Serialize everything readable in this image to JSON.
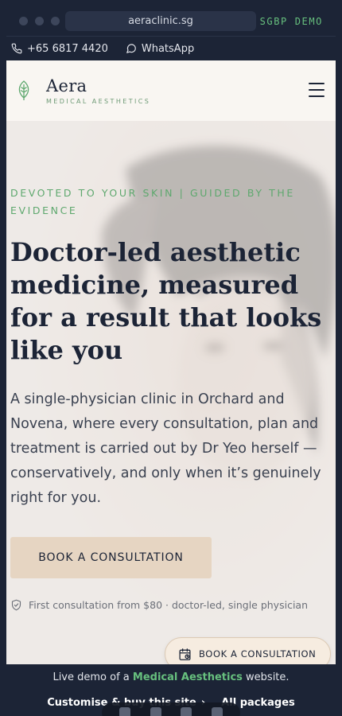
{
  "browser": {
    "url": "aeraclinic.sg",
    "demo_tag": "SGBP DEMO"
  },
  "contact": {
    "phone": "+65 6817 4420",
    "whatsapp": "WhatsApp"
  },
  "header": {
    "brand_name": "Aera",
    "brand_sub": "MEDICAL AESTHETICS"
  },
  "hero": {
    "eyebrow": "DEVOTED TO YOUR SKIN   |   GUIDED BY THE EVIDENCE",
    "title": "Doctor-led aesthetic medicine, measured for a result that looks like you",
    "lead": "A single-physician clinic in Orchard and Novena, where every consultation, plan and treatment is carried out by Dr Yeo herself — conservatively, and only when it’s genuinely right for you.",
    "cta_label": "BOOK A CONSULTATION",
    "assurance": "First consultation from $80 · doctor-led, single physician",
    "float_cta_label": "BOOK A CONSULTATION"
  },
  "banner": {
    "prefix": "Live demo of a ",
    "highlight": "Medical Aesthetics",
    "suffix": " website.",
    "customise_label": "Customise & buy this site",
    "packages_label": "All packages"
  },
  "colors": {
    "navy": "#1c2436",
    "accent_green": "#5ea86e",
    "cta_beige": "#e6d5c2",
    "header_bg": "#f9f6f2"
  }
}
